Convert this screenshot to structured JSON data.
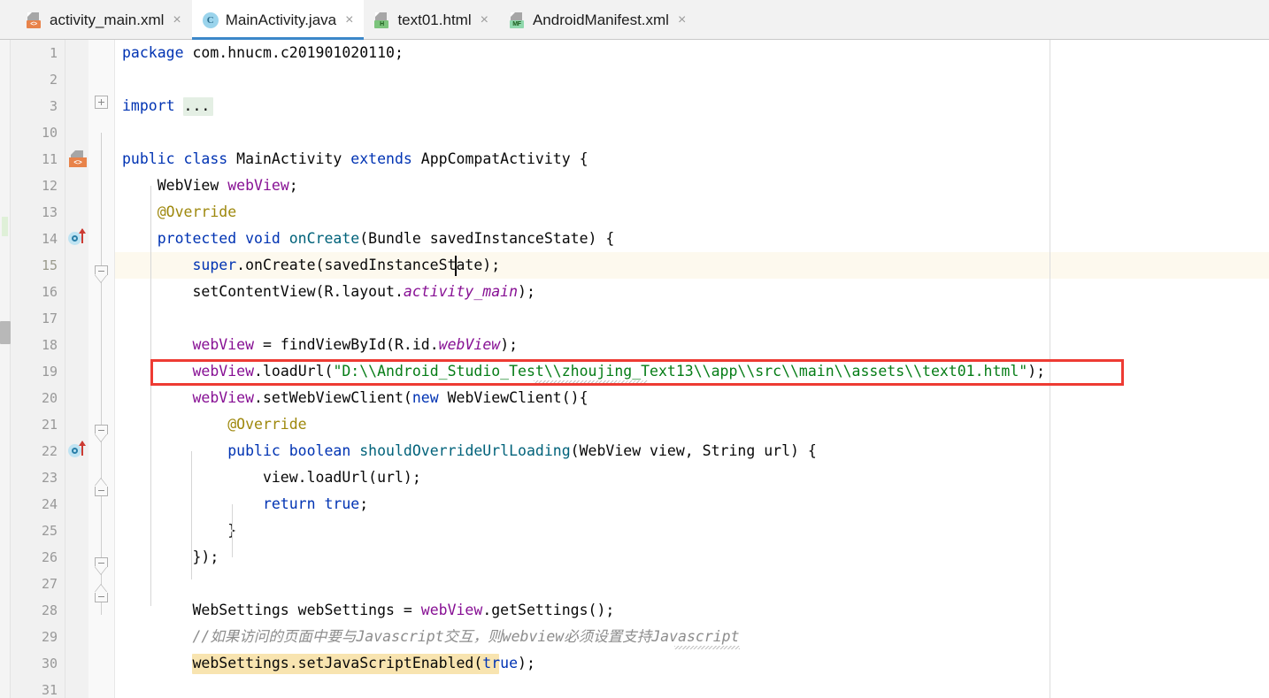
{
  "window": {
    "title": "MainActivity.java",
    "app": "Android Studio Editor"
  },
  "tabs": [
    {
      "label": "activity_main.xml",
      "icon": "xml-layout-file-icon",
      "badge": "<>",
      "close": "×",
      "active": false
    },
    {
      "label": "MainActivity.java",
      "icon": "java-class-file-icon",
      "badge": "C",
      "close": "×",
      "active": true
    },
    {
      "label": "text01.html",
      "icon": "html-file-icon",
      "badge": "H",
      "close": "×",
      "active": false
    },
    {
      "label": "AndroidManifest.xml",
      "icon": "manifest-file-icon",
      "badge": "MF",
      "close": "×",
      "active": false
    }
  ],
  "editor": {
    "line_numbers": [
      "1",
      "2",
      "3",
      "10",
      "11",
      "12",
      "13",
      "14",
      "15",
      "16",
      "17",
      "18",
      "19",
      "20",
      "21",
      "22",
      "23",
      "24",
      "25",
      "26",
      "27",
      "28",
      "29",
      "30",
      "31"
    ],
    "current_line": "15",
    "folded_import_placeholder": "...",
    "gutter_markers": [
      {
        "line": "11",
        "type": "layout-resource-icon",
        "badge": "<>"
      },
      {
        "line": "14",
        "type": "overriding-method-icon"
      },
      {
        "line": "22",
        "type": "overriding-method-icon"
      }
    ],
    "highlight_box_line": "19",
    "highlight_box_color": "#ee3b33",
    "search_match_line": "30",
    "search_match_color": "#f8e4b0",
    "current_line_color": "#fdf9ee",
    "caret_line": "15",
    "lines": [
      {
        "n": "1",
        "tokens": [
          {
            "t": "package ",
            "c": "kw"
          },
          {
            "t": "com.hnucm.c201901020110;",
            "c": "pln"
          }
        ]
      },
      {
        "n": "2",
        "tokens": []
      },
      {
        "n": "3",
        "tokens": [
          {
            "t": "import ",
            "c": "kw"
          },
          {
            "t": "...",
            "c": "pln"
          }
        ]
      },
      {
        "n": "10",
        "tokens": []
      },
      {
        "n": "11",
        "tokens": [
          {
            "t": "public ",
            "c": "kw"
          },
          {
            "t": "class ",
            "c": "kw"
          },
          {
            "t": "MainActivity ",
            "c": "pln"
          },
          {
            "t": "extends ",
            "c": "kw"
          },
          {
            "t": "AppCompatActivity {",
            "c": "pln"
          }
        ]
      },
      {
        "n": "12",
        "tokens": [
          {
            "t": "    WebView ",
            "c": "pln"
          },
          {
            "t": "webView",
            "c": "fld"
          },
          {
            "t": ";",
            "c": "pln"
          }
        ]
      },
      {
        "n": "13",
        "tokens": [
          {
            "t": "    @Override",
            "c": "ann"
          }
        ]
      },
      {
        "n": "14",
        "tokens": [
          {
            "t": "    protected ",
            "c": "kw"
          },
          {
            "t": "void ",
            "c": "kw"
          },
          {
            "t": "onCreate",
            "c": "mcall"
          },
          {
            "t": "(Bundle savedInstanceState) {",
            "c": "pln"
          }
        ]
      },
      {
        "n": "15",
        "tokens": [
          {
            "t": "        super",
            "c": "kw"
          },
          {
            "t": ".onCreate(savedInstanceState);",
            "c": "pln"
          }
        ]
      },
      {
        "n": "16",
        "tokens": [
          {
            "t": "        setContentView(R.layout.",
            "c": "pln"
          },
          {
            "t": "activity_main",
            "c": "fldi"
          },
          {
            "t": ");",
            "c": "pln"
          }
        ]
      },
      {
        "n": "17",
        "tokens": []
      },
      {
        "n": "18",
        "tokens": [
          {
            "t": "        ",
            "c": "pln"
          },
          {
            "t": "webView",
            "c": "fld"
          },
          {
            "t": " = findViewById(R.id.",
            "c": "pln"
          },
          {
            "t": "webView",
            "c": "fldi"
          },
          {
            "t": ");",
            "c": "pln"
          }
        ]
      },
      {
        "n": "19",
        "tokens": [
          {
            "t": "        ",
            "c": "pln"
          },
          {
            "t": "webView",
            "c": "fld"
          },
          {
            "t": ".loadUrl(",
            "c": "pln"
          },
          {
            "t": "\"D:\\\\Android_Studio_Test\\\\zhoujing_Text13\\\\app\\\\src\\\\main\\\\assets\\\\text01.html\"",
            "c": "str"
          },
          {
            "t": ");",
            "c": "pln"
          }
        ]
      },
      {
        "n": "20",
        "tokens": [
          {
            "t": "        ",
            "c": "pln"
          },
          {
            "t": "webView",
            "c": "fld"
          },
          {
            "t": ".setWebViewClient(",
            "c": "pln"
          },
          {
            "t": "new ",
            "c": "kw"
          },
          {
            "t": "WebViewClient(){",
            "c": "pln"
          }
        ]
      },
      {
        "n": "21",
        "tokens": [
          {
            "t": "            @Override",
            "c": "ann"
          }
        ]
      },
      {
        "n": "22",
        "tokens": [
          {
            "t": "            public ",
            "c": "kw"
          },
          {
            "t": "boolean ",
            "c": "kw"
          },
          {
            "t": "shouldOverrideUrlLoading",
            "c": "mcall"
          },
          {
            "t": "(WebView view, String url) {",
            "c": "pln"
          }
        ]
      },
      {
        "n": "23",
        "tokens": [
          {
            "t": "                view.loadUrl(url);",
            "c": "pln"
          }
        ]
      },
      {
        "n": "24",
        "tokens": [
          {
            "t": "                return ",
            "c": "kw"
          },
          {
            "t": "true",
            "c": "kw"
          },
          {
            "t": ";",
            "c": "pln"
          }
        ]
      },
      {
        "n": "25",
        "tokens": [
          {
            "t": "            }",
            "c": "pln"
          }
        ]
      },
      {
        "n": "26",
        "tokens": [
          {
            "t": "        });",
            "c": "pln"
          }
        ]
      },
      {
        "n": "27",
        "tokens": []
      },
      {
        "n": "28",
        "tokens": [
          {
            "t": "        WebSettings webSettings = ",
            "c": "pln"
          },
          {
            "t": "webView",
            "c": "fld"
          },
          {
            "t": ".getSettings();",
            "c": "pln"
          }
        ]
      },
      {
        "n": "29",
        "tokens": [
          {
            "t": "        //如果访问的页面中要与Javascript交互，则webview必须设置支持Javascript",
            "c": "cmt"
          }
        ]
      },
      {
        "n": "30",
        "tokens": [
          {
            "t": "        webSettings.setJavaScriptEnabled(",
            "c": "pln"
          },
          {
            "t": "true",
            "c": "kw"
          },
          {
            "t": ");",
            "c": "pln"
          }
        ]
      },
      {
        "n": "31",
        "tokens": []
      }
    ]
  },
  "colors": {
    "keyword": "#0033b3",
    "string": "#067d17",
    "comment": "#8c8c8c",
    "field": "#871094",
    "annotation": "#9e880d",
    "method": "#00627a",
    "tab_active_underline": "#3c87c9"
  }
}
